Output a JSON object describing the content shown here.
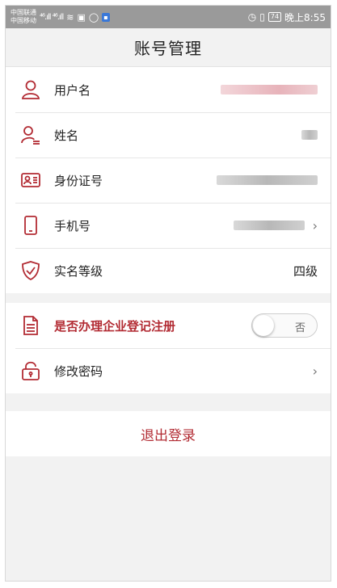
{
  "status_bar": {
    "carrier1": "中国联通",
    "carrier2": "中国移动",
    "signal": "⁴⁶.ıll ⁴⁶.ıll",
    "battery": "74",
    "time": "晚上8:55"
  },
  "header": {
    "title": "账号管理"
  },
  "account_rows": [
    {
      "label": "用户名",
      "icon": "user-icon"
    },
    {
      "label": "姓名",
      "icon": "name-card-user-icon"
    },
    {
      "label": "身份证号",
      "icon": "id-card-icon"
    },
    {
      "label": "手机号",
      "icon": "phone-icon",
      "chevron": "›"
    },
    {
      "label": "实名等级",
      "icon": "shield-check-icon",
      "value": "四级"
    }
  ],
  "business_row": {
    "label": "是否办理企业登记注册",
    "icon": "document-icon",
    "toggle_text": "否"
  },
  "password_row": {
    "label": "修改密码",
    "icon": "lock-icon",
    "chevron": "›"
  },
  "logout": {
    "label": "退出登录"
  },
  "colors": {
    "accent": "#b22b33",
    "background": "#f2f2f2"
  }
}
